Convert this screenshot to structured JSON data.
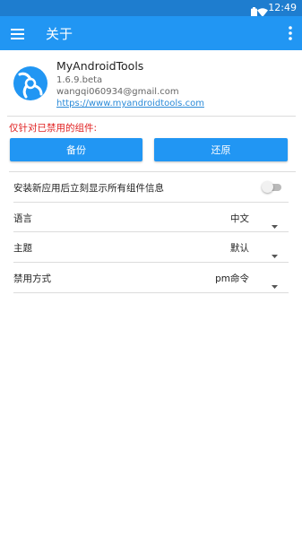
{
  "status_bar": {
    "time": "12:49",
    "icons": [
      "battery-icon",
      "wifi-icon"
    ]
  },
  "app_bar": {
    "title": "关于",
    "menu_icon": "hamburger-menu-icon",
    "overflow_icon": "more-vert-icon",
    "color": "#2196f3",
    "status_color": "#1e7dcf"
  },
  "about": {
    "logo_icon": "app-logo-icon",
    "name": "MyAndroidTools",
    "version": "1.6.9.beta",
    "email": "wangqi060934@gmail.com",
    "url": "https://www.myandroidtools.com",
    "accent": "#2a8ad8"
  },
  "backup": {
    "warning": "仅针对已禁用的组件:",
    "warning_color": "#e02020",
    "backup_label": "备份",
    "restore_label": "还原"
  },
  "settings": {
    "auto_show": {
      "label": "安装新应用后立刻显示所有组件信息",
      "enabled": false
    },
    "language": {
      "label": "语言",
      "value": "中文"
    },
    "theme": {
      "label": "主题",
      "value": "默认"
    },
    "disable_method": {
      "label": "禁用方式",
      "value": "pm命令"
    }
  }
}
